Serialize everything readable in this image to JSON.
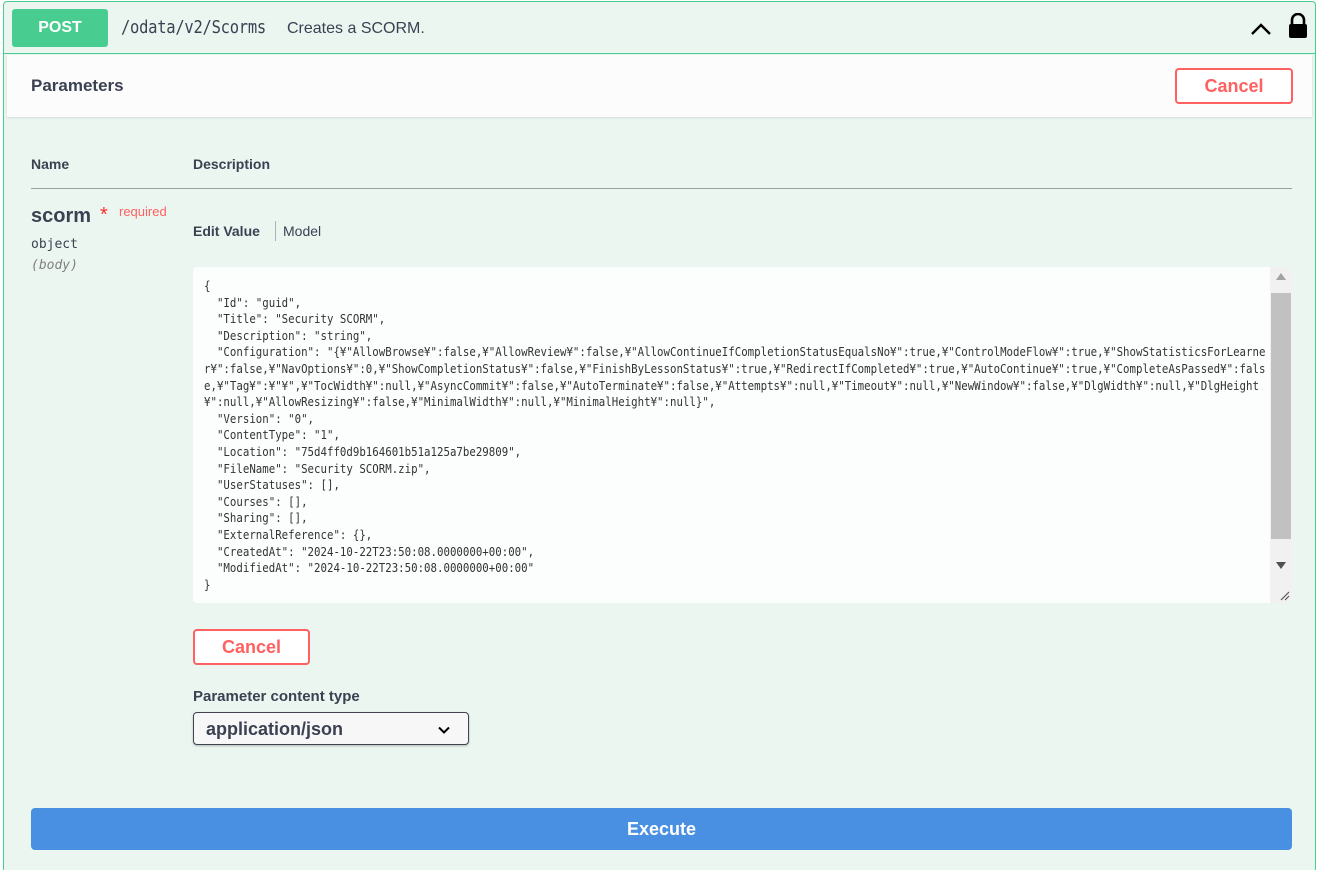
{
  "operation": {
    "method": "POST",
    "path": "/odata/v2/Scorms",
    "summary": "Creates a SCORM.",
    "method_color": "#49cc90",
    "collapse_icon": "chevron-up-icon",
    "auth_icon": "lock-icon"
  },
  "parameters": {
    "title": "Parameters",
    "cancel_label": "Cancel",
    "col_name": "Name",
    "col_description": "Description"
  },
  "param": {
    "name": "scorm",
    "required_star": "*",
    "required_label": "required",
    "type": "object",
    "in": "(body)",
    "tab_edit": "Edit Value",
    "tab_model": "Model",
    "body_value": "{\n  \"Id\": \"guid\",\n  \"Title\": \"Security SCORM\",\n  \"Description\": \"string\",\n  \"Configuration\": \"{¥\"AllowBrowse¥\":false,¥\"AllowReview¥\":false,¥\"AllowContinueIfCompletionStatusEqualsNo¥\":true,¥\"ControlModeFlow¥\":true,¥\"ShowStatisticsForLearner¥\":false,¥\"NavOptions¥\":0,¥\"ShowCompletionStatus¥\":false,¥\"FinishByLessonStatus¥\":true,¥\"RedirectIfCompleted¥\":true,¥\"AutoContinue¥\":true,¥\"CompleteAsPassed¥\":false,¥\"Tag¥\":¥\"¥\",¥\"TocWidth¥\":null,¥\"AsyncCommit¥\":false,¥\"AutoTerminate¥\":false,¥\"Attempts¥\":null,¥\"Timeout¥\":null,¥\"NewWindow¥\":false,¥\"DlgWidth¥\":null,¥\"DlgHeight¥\":null,¥\"AllowResizing¥\":false,¥\"MinimalWidth¥\":null,¥\"MinimalHeight¥\":null}\",\n  \"Version\": \"0\",\n  \"ContentType\": \"1\",\n  \"Location\": \"75d4ff0d9b164601b51a125a7be29809\",\n  \"FileName\": \"Security SCORM.zip\",\n  \"UserStatuses\": [],\n  \"Courses\": [],\n  \"Sharing\": [],\n  \"ExternalReference\": {},\n  \"CreatedAt\": \"2024-10-22T23:50:08.0000000+00:00\",\n  \"ModifiedAt\": \"2024-10-22T23:50:08.0000000+00:00\"\n}",
    "cancel_label": "Cancel",
    "content_type_label": "Parameter content type",
    "content_type_value": "application/json"
  },
  "execute_label": "Execute",
  "colors": {
    "execute": "#4990e2",
    "cancel": "#ff6060",
    "panel_bg": "#ebf6f1"
  }
}
